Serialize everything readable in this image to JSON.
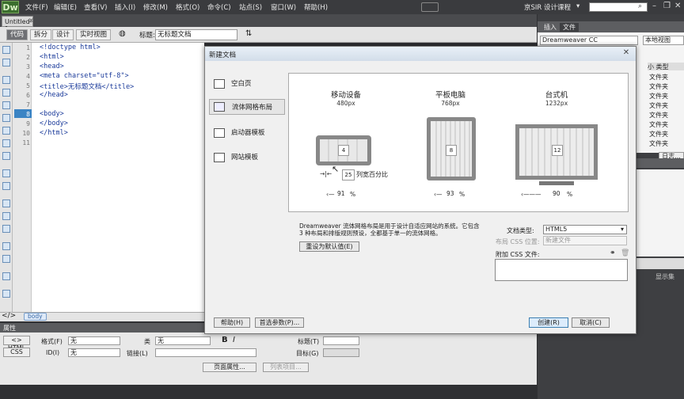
{
  "app": {
    "logo": "Dw",
    "user": "京SIR 设计课程"
  },
  "menu": [
    "文件(F)",
    "编辑(E)",
    "查看(V)",
    "插入(I)",
    "修改(M)",
    "格式(O)",
    "命令(C)",
    "站点(S)",
    "窗口(W)",
    "帮助(H)"
  ],
  "window_controls": {
    "min": "–",
    "restore": "❐",
    "close": "✕"
  },
  "doc_tab": {
    "label": "Untitled-1",
    "close": "×"
  },
  "toolbar": {
    "code": "代码",
    "split": "拆分",
    "design": "设计",
    "live": "实时视图",
    "title_label": "标题:",
    "title_value": "无标题文档"
  },
  "code_lines": [
    {
      "n": "1",
      "t": "<!doctype html>"
    },
    {
      "n": "2",
      "t": "<html>"
    },
    {
      "n": "3",
      "t": "<head>"
    },
    {
      "n": "4",
      "t": "<meta charset=\"utf-8\">"
    },
    {
      "n": "5",
      "t": "<title>无标题文档</title>"
    },
    {
      "n": "6",
      "t": "</head>"
    },
    {
      "n": "7",
      "t": ""
    },
    {
      "n": "8",
      "t": "<body>"
    },
    {
      "n": "9",
      "t": "</body>"
    },
    {
      "n": "10",
      "t": "</html>"
    },
    {
      "n": "11",
      "t": ""
    }
  ],
  "status": {
    "arrows": "</>",
    "tag": "body"
  },
  "properties": {
    "header": "属性",
    "html_btn": "<> HTML",
    "css_btn": "CSS",
    "format_label": "格式(F)",
    "format_value": "无",
    "class_label": "类",
    "class_value": "无",
    "bold": "B",
    "italic": "I",
    "title_label": "标题(T)",
    "id_label": "ID(I)",
    "id_value": "无",
    "link_label": "链接(L)",
    "target_label": "目标(G)",
    "page_props_btn": "页面属性...",
    "list_item_btn": "列表项目..."
  },
  "right_panel": {
    "tab_insert": "插入",
    "tab_files": "文件",
    "site": "Dreamweaver CC",
    "view": "本地视图",
    "type_header": "小 类型",
    "types": [
      "文件夹",
      "文件夹",
      "文件夹",
      "文件夹",
      "文件夹",
      "文件夹",
      "文件夹",
      "文件夹"
    ],
    "log_btn": "日志...",
    "show_all": "显示集"
  },
  "dialog": {
    "title": "新建文档",
    "close": "✕",
    "nav": [
      "空白页",
      "流体网格布局",
      "启动器模板",
      "网站模板"
    ],
    "devices": [
      {
        "name": "移动设备",
        "px": "480px",
        "cols": "4",
        "pct": "91"
      },
      {
        "name": "平板电脑",
        "px": "768px",
        "cols": "8",
        "pct": "93"
      },
      {
        "name": "台式机",
        "px": "1232px",
        "cols": "12",
        "pct": "90"
      }
    ],
    "gutter_value": "25",
    "gutter_label": "列宽百分比",
    "pct_sign": "%",
    "description": "Dreamweaver 流体网格布局是用于设计自适应网站的系统。它包含 3 种布局和排版规则预设，全都基于单一的流体网格。",
    "reset_btn": "重设为默认值(E)",
    "doctype_label": "文档类型:",
    "doctype_value": "HTML5",
    "layout_css_label": "布局 CSS 位置:",
    "layout_css_value": "新建文件",
    "attach_css_label": "附加 CSS 文件:",
    "help_btn": "帮助(H)",
    "prefs_btn": "首选参数(P)...",
    "create_btn": "创建(R)",
    "cancel_btn": "取消(C)"
  }
}
